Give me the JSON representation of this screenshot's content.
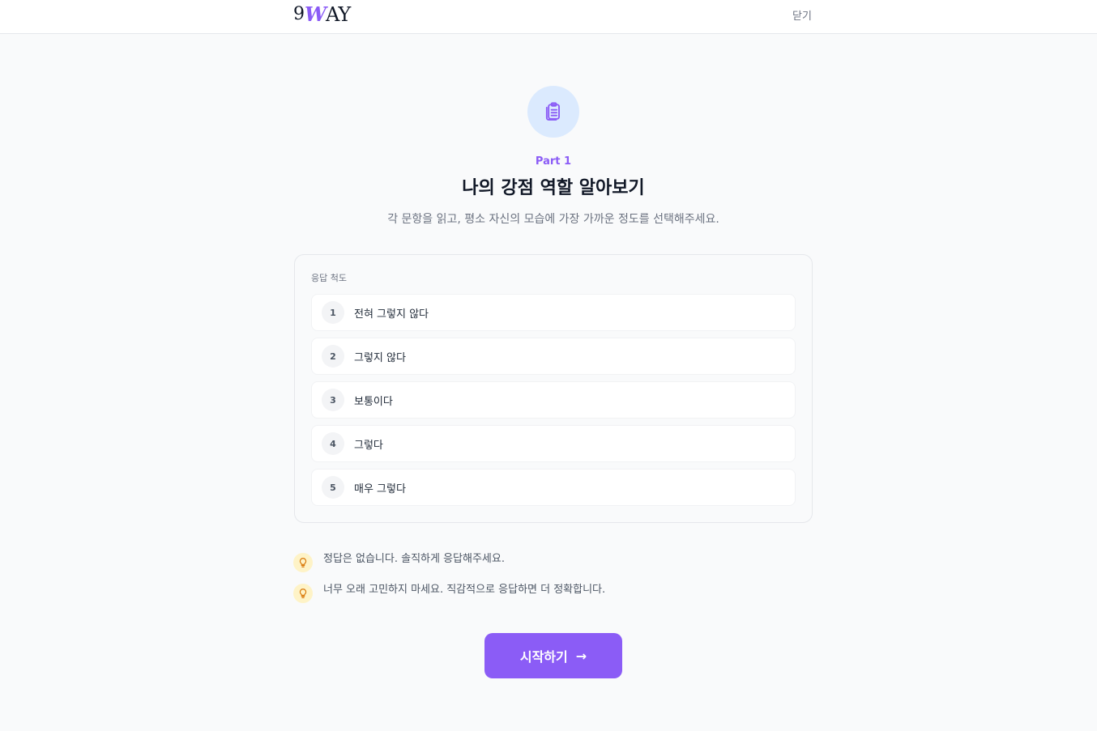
{
  "header": {
    "logo": {
      "nine": "9",
      "w": "W",
      "ay": "AY"
    },
    "close_label": "닫기"
  },
  "intro": {
    "icon": "clipboard-list-icon",
    "part_label": "Part 1",
    "title": "나의 강점 역할 알아보기",
    "subtitle": "각 문항을 읽고, 평소 자신의 모습에 가장 가까운 정도를 선택해주세요."
  },
  "scale": {
    "title": "응답 척도",
    "items": [
      {
        "num": "1",
        "label": "전혀 그렇지 않다"
      },
      {
        "num": "2",
        "label": "그렇지 않다"
      },
      {
        "num": "3",
        "label": "보통이다"
      },
      {
        "num": "4",
        "label": "그렇다"
      },
      {
        "num": "5",
        "label": "매우 그렇다"
      }
    ]
  },
  "tips": [
    {
      "icon": "lightbulb-icon",
      "text": "정답은 없습니다. 솔직하게 응답해주세요."
    },
    {
      "icon": "lightbulb-icon",
      "text": "너무 오래 고민하지 마세요. 직감적으로 응답하면 더 정확합니다."
    }
  ],
  "start_button": {
    "label": "시작하기",
    "icon": "arrow-right-icon"
  },
  "colors": {
    "accent": "#8b5cf6",
    "icon_circle": "#dbeafe",
    "tip_circle": "#fef3c7",
    "tip_icon": "#d97706"
  }
}
